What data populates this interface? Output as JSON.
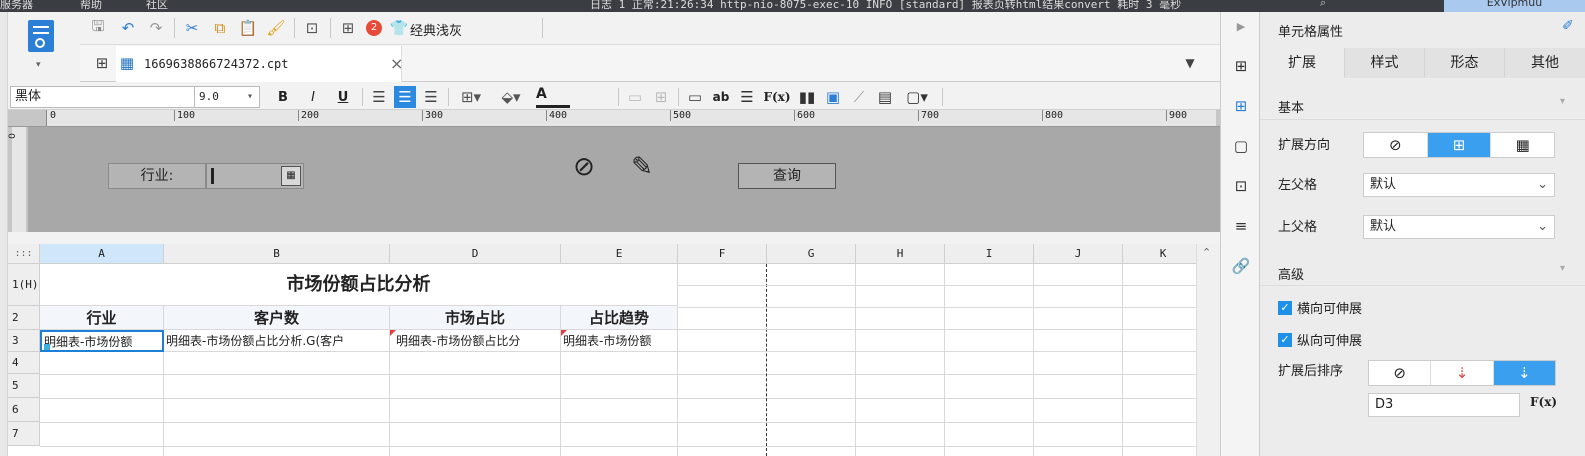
{
  "menubar": {
    "items": [
      "服务器",
      "帮助",
      "社区"
    ],
    "log": "日志 1 正常:21:26:34 http-nio-8075-exec-10 INFO [standard] 报表页转html结果convert  耗时 3 毫秒",
    "user": "ExVipmuu"
  },
  "toolbar": {
    "style_label": "经典浅灰",
    "badge": "2"
  },
  "tab": {
    "filename": "1669638866724372.cpt",
    "close": "×"
  },
  "format": {
    "font": "黑体",
    "size": "9.0",
    "bold": "B",
    "italic": "I",
    "underline": "U",
    "font_color": "A",
    "text_ab": "ab",
    "formula": "F(x)"
  },
  "ruler": {
    "marks": [
      "0",
      "100",
      "200",
      "300",
      "400",
      "500",
      "600",
      "700",
      "800",
      "900"
    ]
  },
  "params": {
    "industry_label": "行业:",
    "query_label": "查询"
  },
  "sheet": {
    "corner": ":::",
    "columns": [
      "A",
      "B",
      "D",
      "E",
      "F",
      "G",
      "H",
      "I",
      "J",
      "K"
    ],
    "rows": [
      "1(H)",
      "2",
      "3",
      "4",
      "5",
      "6",
      "7"
    ],
    "title": "市场份额占比分析",
    "headers": [
      "行业",
      "客户数",
      "市场占比",
      "占比趋势"
    ],
    "row3": [
      "明细表-市场份额",
      "明细表-市场份额占比分析.G(客户",
      "明细表-市场份额占比分",
      "明细表-市场份额"
    ]
  },
  "panel": {
    "title": "单元格属性",
    "tabs": [
      "扩展",
      "样式",
      "形态",
      "其他"
    ],
    "basic": "基本",
    "direction_label": "扩展方向",
    "left_parent_label": "左父格",
    "left_parent_value": "默认",
    "top_parent_label": "上父格",
    "top_parent_value": "默认",
    "advanced": "高级",
    "horizontal_extend": "横向可伸展",
    "vertical_extend": "纵向可伸展",
    "sort_label": "扩展后排序",
    "sort_field": "D3",
    "fx": "F(x)"
  },
  "colors": {
    "accent": "#1e90e8",
    "selected": "#3b9ff0",
    "panel_bg": "#ececec"
  }
}
